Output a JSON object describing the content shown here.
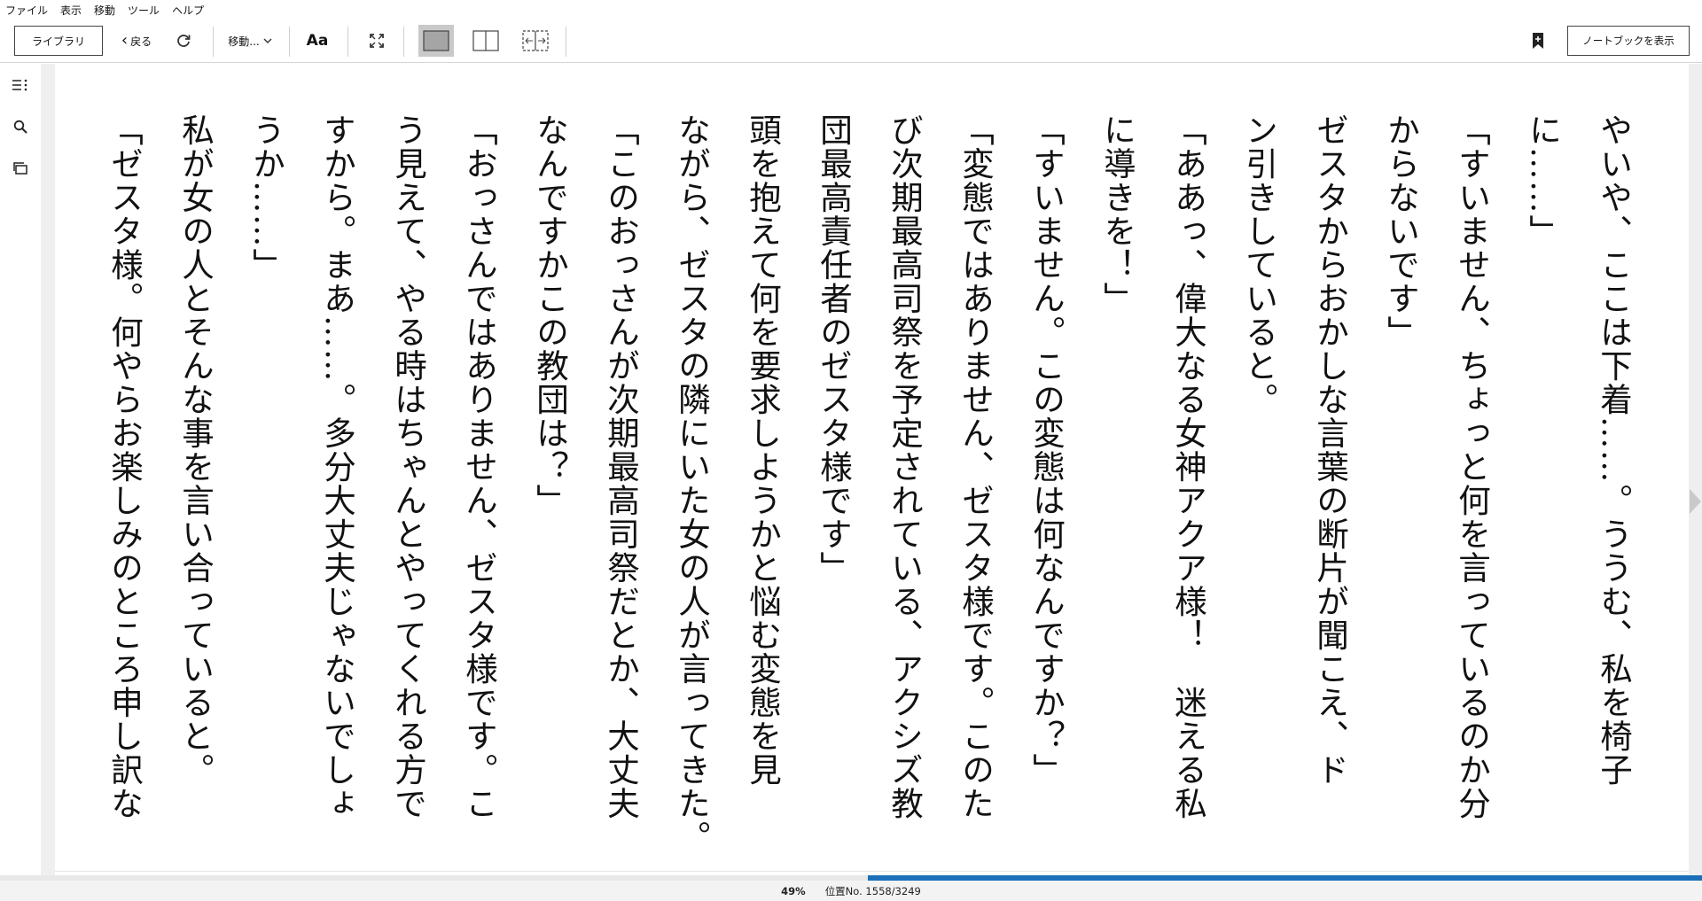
{
  "menu": {
    "items": [
      "ファイル",
      "表示",
      "移動",
      "ツール",
      "ヘルプ"
    ]
  },
  "toolbar": {
    "library_label": "ライブラリ",
    "back_label": "戻る",
    "goto_label": "移動...",
    "font_label": "Aa",
    "notebook_label": "ノートブックを表示"
  },
  "icons": {
    "refresh": "refresh-icon",
    "fullscreen": "fullscreen-icon",
    "single_page": "single-page-layout-icon",
    "two_page": "two-page-layout-icon",
    "fit_width": "fit-width-layout-icon",
    "bookmark": "add-bookmark-icon",
    "toc": "table-of-contents-icon",
    "search": "search-icon",
    "flashcards": "flashcards-icon"
  },
  "colors": {
    "progress": "#1a6fb8",
    "active_layout": "#c9c9c9"
  },
  "reader": {
    "columns": [
      "やいや、ここは下着……。ううむ、私を椅子",
      "に……」",
      "「すいません、ちょっと何を言っているのか分",
      "からないです」",
      "ゼスタからおかしな言葉の断片が聞こえ、ド",
      "ン引きしていると。",
      "「ああっ、偉大なる女神アクア様！　迷える私",
      "に導きを！」",
      "「すいません。この変態は何なんですか？」",
      "「変態ではありません、ゼスタ様です。このた",
      "び次期最高司祭を予定されている、アクシズ教",
      "団最高責任者のゼスタ様です」",
      "頭を抱えて何を要求しようかと悩む変態を見",
      "ながら、ゼスタの隣にいた女の人が言ってきた。",
      "「このおっさんが次期最高司祭だとか、大丈夫",
      "なんですかこの教団は？」",
      "「おっさんではありません、ゼスタ様です。こ",
      "う見えて、やる時はちゃんとやってくれる方で",
      "すから。まあ……。多分大丈夫じゃないでしょ",
      "うか……」",
      "私が女の人とそんな事を言い合っていると。",
      "「ゼスタ様。何やらお楽しみのところ申し訳な"
    ],
    "progress_fraction": 0.49
  },
  "status": {
    "percent": "49%",
    "location": "位置No. 1558/3249"
  }
}
